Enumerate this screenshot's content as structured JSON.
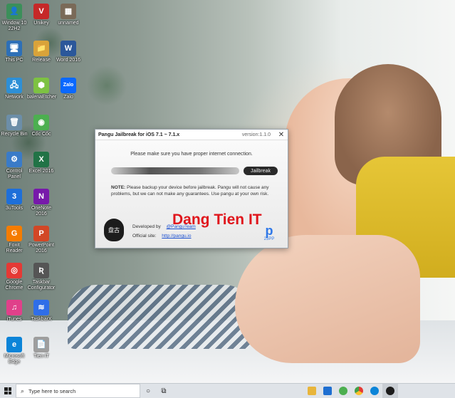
{
  "desktop": {
    "icons": [
      {
        "label": "Window 10 22H2",
        "glyph": "👤",
        "color": "#3b8f5a"
      },
      {
        "label": "Unikey",
        "glyph": "V",
        "color": "#c62828"
      },
      {
        "label": "unnamed",
        "glyph": "▦",
        "color": "#7a6a58"
      },
      {
        "label": "This PC",
        "glyph": "🖥",
        "color": "#2d6fb7"
      },
      {
        "label": "Release",
        "glyph": "📁",
        "color": "#d9a33a"
      },
      {
        "label": "Word 2016",
        "glyph": "W",
        "color": "#2b579a"
      },
      {
        "label": "Network",
        "glyph": "🖧",
        "color": "#2d8fd6"
      },
      {
        "label": "balenaEtcher",
        "glyph": "⬢",
        "color": "#7dc242"
      },
      {
        "label": "Zalo",
        "glyph": "Zalo",
        "color": "#0a68ff"
      },
      {
        "label": "Recycle Bin",
        "glyph": "🗑",
        "color": "#6c8ea8"
      },
      {
        "label": "Cốc Cốc",
        "glyph": "◉",
        "color": "#4caf50"
      },
      {
        "label": "Control Panel",
        "glyph": "⚙",
        "color": "#3a7bc8"
      },
      {
        "label": "Excel 2016",
        "glyph": "X",
        "color": "#217346"
      },
      {
        "label": "3uTools",
        "glyph": "3",
        "color": "#1e6fd9"
      },
      {
        "label": "OneNote 2016",
        "glyph": "N",
        "color": "#7719aa"
      },
      {
        "label": "Foxit Reader",
        "glyph": "G",
        "color": "#f57c00"
      },
      {
        "label": "PowerPoint 2016",
        "glyph": "P",
        "color": "#d24726"
      },
      {
        "label": "Google Chrome",
        "glyph": "◎",
        "color": "#e53935"
      },
      {
        "label": "Taskbar Configurator",
        "glyph": "Ʀ",
        "color": "#555555"
      },
      {
        "label": "iTunes",
        "glyph": "♫",
        "color": "#e0408a"
      },
      {
        "label": "TaskbarX",
        "glyph": "≋",
        "color": "#2f6ee8"
      },
      {
        "label": "Microsoft Edge",
        "glyph": "e",
        "color": "#0b84d8"
      },
      {
        "label": "Tien IT",
        "glyph": "📄",
        "color": "#9e9e9e"
      }
    ]
  },
  "dialog": {
    "title": "Pangu Jailbreak for iOS 7.1 ~ 7.1.x",
    "version": "version:1.1.0",
    "close": "✕",
    "connection_msg": "Please make sure you have proper internet connection.",
    "jailbreak_label": "Jailbreak",
    "note_label": "NOTE:",
    "note_text": "Please backup your device before jailbreak. Pangu will not cause any problems, but we can not make any guarantees. Use pangu at your own risk.",
    "logo_text": "盘古",
    "developed_by_label": "Developed by",
    "developed_by_value": "@PanguTeam",
    "official_site_label": "Official site:",
    "official_site_value": "http://pangu.io",
    "partner_label": "25PP",
    "partner_glyph": "p"
  },
  "watermark": "Dang Tien IT",
  "taskbar": {
    "search_placeholder": "Type here to search",
    "search_icon": "search-icon",
    "task_view_icon": "task-view-icon"
  }
}
